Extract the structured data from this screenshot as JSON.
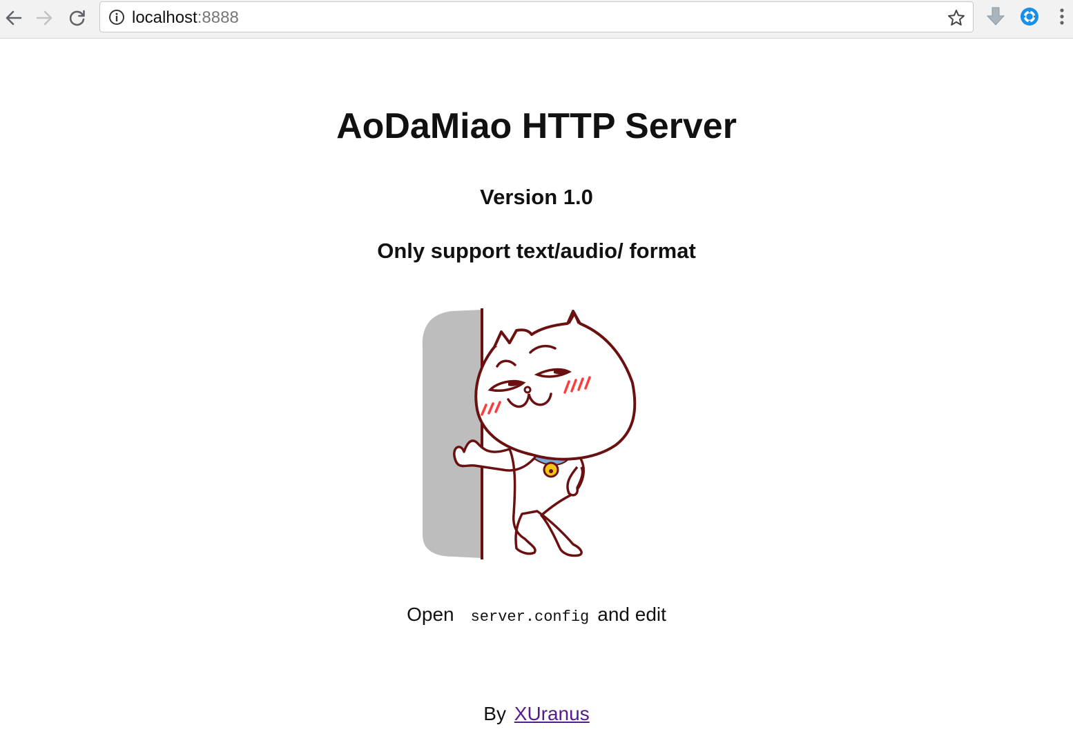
{
  "browser": {
    "url_host": "localhost",
    "url_port": ":8888",
    "icons": {
      "back": "arrow-left-icon",
      "forward": "arrow-right-icon",
      "reload": "reload-icon",
      "site_info": "info-icon",
      "bookmark": "star-icon",
      "extension_1": "download-arrow-icon",
      "extension_2": "blue-circle-extension-icon",
      "menu": "vertical-dots-icon"
    },
    "colors": {
      "toolbar_bg": "#f2f2f2",
      "extension_blue": "#1a8fe8",
      "link_visited": "#551a8b"
    }
  },
  "page": {
    "title": "AoDaMiao HTTP Server",
    "version": "Version 1.0",
    "support": "Only support text/audio/ format",
    "mascot_icon": "cat-mascot-leaning-on-wall-image",
    "open_prefix": "Open",
    "open_code": "server.config",
    "open_suffix": "and edit",
    "by_prefix": "By",
    "author_link": "XUranus"
  }
}
